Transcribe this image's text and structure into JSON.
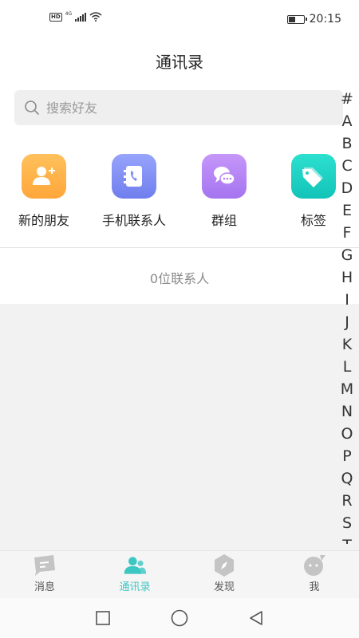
{
  "status_bar": {
    "hd_label": "HD",
    "network_label": "4G",
    "time": "20:15",
    "battery_level": 0.4
  },
  "header": {
    "title": "通讯录"
  },
  "search": {
    "placeholder": "搜索好友"
  },
  "shortcuts": [
    {
      "label": "新的朋友",
      "icon": "add-friend-icon",
      "color": "#ffb246"
    },
    {
      "label": "手机联系人",
      "icon": "phone-contacts-icon",
      "color": "#7f8ff5"
    },
    {
      "label": "群组",
      "icon": "group-chat-icon",
      "color": "#b685f4"
    },
    {
      "label": "标签",
      "icon": "tag-icon",
      "color": "#1ed3c4"
    }
  ],
  "contacts": {
    "count_text": "0位联系人"
  },
  "index_bar": {
    "letters": [
      "#",
      "A",
      "B",
      "C",
      "D",
      "E",
      "F",
      "G",
      "H",
      "I",
      "J",
      "K",
      "L",
      "M",
      "N",
      "O",
      "P",
      "Q",
      "R",
      "S",
      "T"
    ]
  },
  "tabs": [
    {
      "label": "消息",
      "icon": "message-icon",
      "active": false
    },
    {
      "label": "通讯录",
      "icon": "contacts-icon",
      "active": true
    },
    {
      "label": "发现",
      "icon": "discover-compass-icon",
      "active": false
    },
    {
      "label": "我",
      "icon": "profile-icon",
      "active": false
    }
  ],
  "colors": {
    "accent": "#3cc7c2",
    "inactive_icon": "#c4c4c4"
  }
}
